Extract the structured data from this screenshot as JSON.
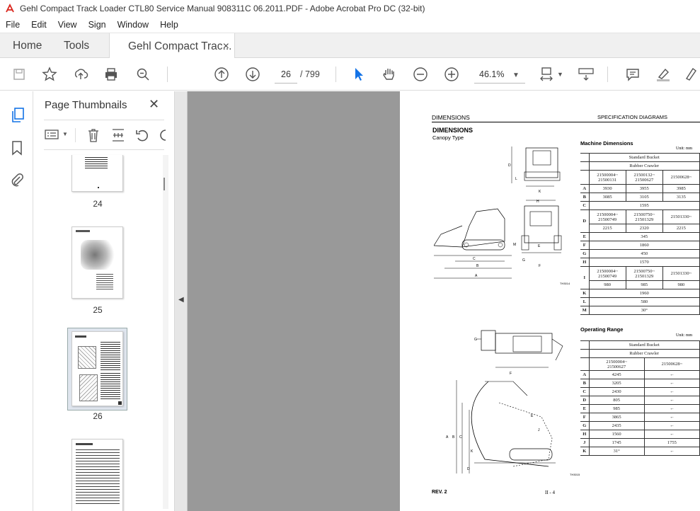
{
  "window": {
    "title": "Gehl Compact Track Loader CTL80 Service Manual 908311C 06.2011.PDF - Adobe Acrobat Pro DC (32-bit)"
  },
  "menu": [
    "File",
    "Edit",
    "View",
    "Sign",
    "Window",
    "Help"
  ],
  "tabs": {
    "home": "Home",
    "tools": "Tools",
    "doc": "Gehl Compact Trac...",
    "close": "×"
  },
  "toolbar": {
    "page_current": "26",
    "page_total": "/  799",
    "zoom": "46.1%"
  },
  "panel": {
    "title": "Page Thumbnails",
    "close": "✕",
    "thumbs": [
      "24",
      "25",
      "26"
    ]
  },
  "doc": {
    "header_left": "DIMENSIONS",
    "header_right": "SPECIFICATION DIAGRAMS",
    "section_title": "DIMENSIONS",
    "section_sub": "Canopy Type",
    "machine_title": "Machine Dimensions",
    "unit": "Unit: mm",
    "operating_title": "Operating Range",
    "standard_bucket": "Standard Bucket",
    "rubber_crawler": "Rubber Crawler",
    "footer_left": "REV. 2",
    "footer_right": "II - 4",
    "fig1_code": "TH3014",
    "fig2_code": "TH3015",
    "machine_rows": [
      [
        "",
        "21500004~\n21500131",
        "21500132~\n21500627",
        "21500628~"
      ],
      [
        "A",
        "3930",
        "3955",
        "3985"
      ],
      [
        "B",
        "3085",
        "3105",
        "3135"
      ],
      [
        "C",
        "1595",
        "",
        ""
      ],
      [
        "D",
        "21500004~\n21500749",
        "21500750~\n21501329",
        "21501330~"
      ],
      [
        "",
        "2215",
        "2320",
        "2215"
      ],
      [
        "E",
        "345",
        "",
        ""
      ],
      [
        "F",
        "1860",
        "",
        ""
      ],
      [
        "G",
        "450",
        "",
        ""
      ],
      [
        "H",
        "1570",
        "",
        ""
      ],
      [
        "I",
        "21500004~\n21500749",
        "21500750~\n21501329",
        "21501330~"
      ],
      [
        "",
        "980",
        "985",
        "980"
      ],
      [
        "K",
        "1960",
        "",
        ""
      ],
      [
        "L",
        "580",
        "",
        ""
      ],
      [
        "M",
        "30°",
        "",
        ""
      ]
    ],
    "operating_rows": [
      [
        "",
        "21500004~\n21500627",
        "21500628~"
      ],
      [
        "A",
        "4245",
        "←"
      ],
      [
        "B",
        "3205",
        "←"
      ],
      [
        "C",
        "2430",
        "←"
      ],
      [
        "D",
        "805",
        "←"
      ],
      [
        "E",
        "985",
        "←"
      ],
      [
        "F",
        "3865",
        "←"
      ],
      [
        "G",
        "2435",
        "←"
      ],
      [
        "H",
        "1560",
        "←"
      ],
      [
        "J",
        "1745",
        "1755"
      ],
      [
        "K",
        "31°",
        "←"
      ]
    ]
  }
}
